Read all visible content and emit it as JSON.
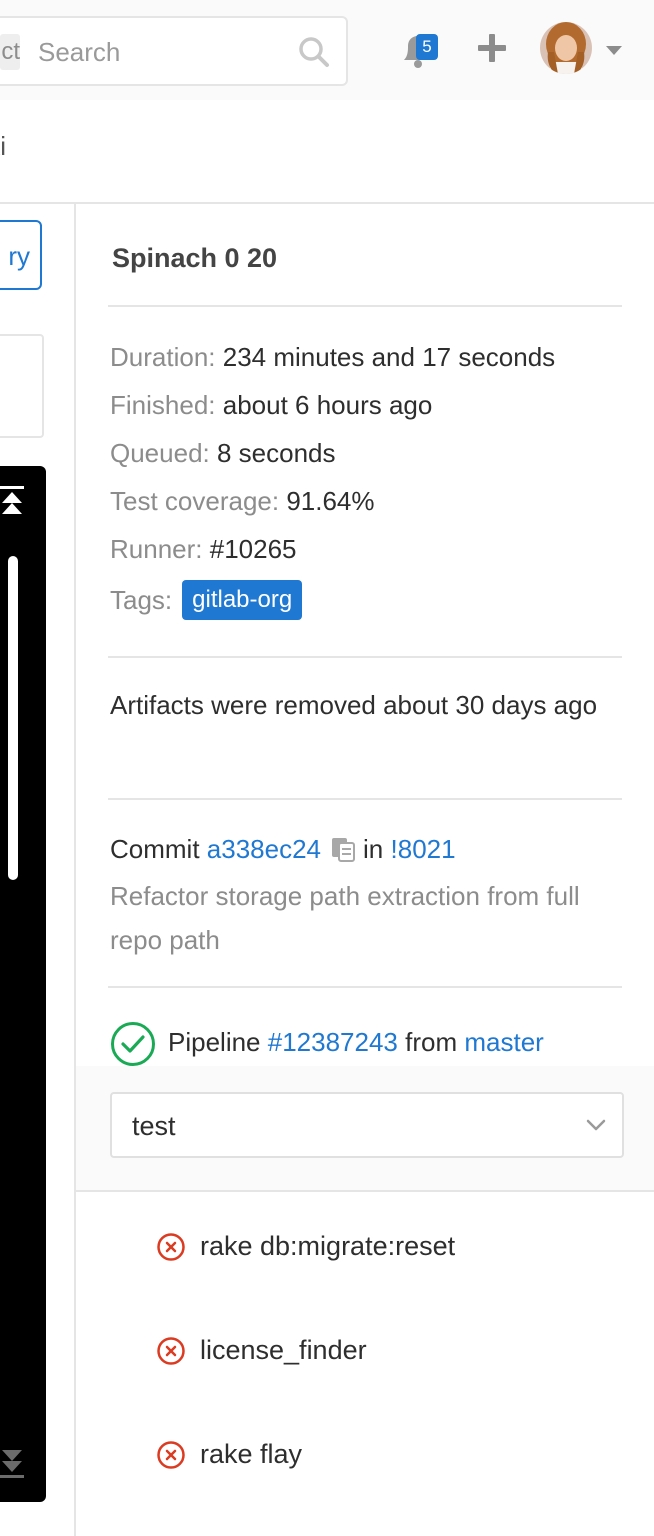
{
  "header": {
    "scope_fragment": "ct",
    "search_placeholder": "Search",
    "notifications_count": "5",
    "nav_fragment": "ki"
  },
  "left": {
    "button_fragment": "ry"
  },
  "job": {
    "title": "Spinach 0 20",
    "details": [
      {
        "label": "Duration:",
        "value": "234 minutes and 17 seconds"
      },
      {
        "label": "Finished:",
        "value": "about 6 hours ago"
      },
      {
        "label": "Queued:",
        "value": "8 seconds"
      },
      {
        "label": "Test coverage:",
        "value": "91.64%"
      },
      {
        "label": "Runner:",
        "value": "#10265"
      }
    ],
    "tags_label": "Tags:",
    "tag": "gitlab-org",
    "artifacts": "Artifacts were removed about 30 days ago",
    "commit_label": "Commit",
    "commit_sha": "a338ec24",
    "commit_in": "in",
    "merge_request": "!8021",
    "commit_message": "Refactor storage path extraction from full repo path",
    "pipeline_label": "Pipeline",
    "pipeline_id": "#12387243",
    "pipeline_from": "from",
    "pipeline_ref": "master",
    "stage_selected": "test",
    "jobs": [
      {
        "name": "rake db:migrate:reset",
        "status": "failed"
      },
      {
        "name": "license_finder",
        "status": "failed"
      },
      {
        "name": "rake flay",
        "status": "failed"
      }
    ]
  },
  "colors": {
    "accent": "#1f78d1",
    "success": "#1aaa55",
    "failed": "#db3b21",
    "log_background": "#000000"
  },
  "icons": [
    "search-icon",
    "bell-icon",
    "plus-icon",
    "caret-down-icon",
    "scroll-top-icon",
    "scroll-bottom-icon",
    "copy-icon",
    "status-success-icon",
    "status-failed-icon",
    "chevron-down-icon"
  ]
}
